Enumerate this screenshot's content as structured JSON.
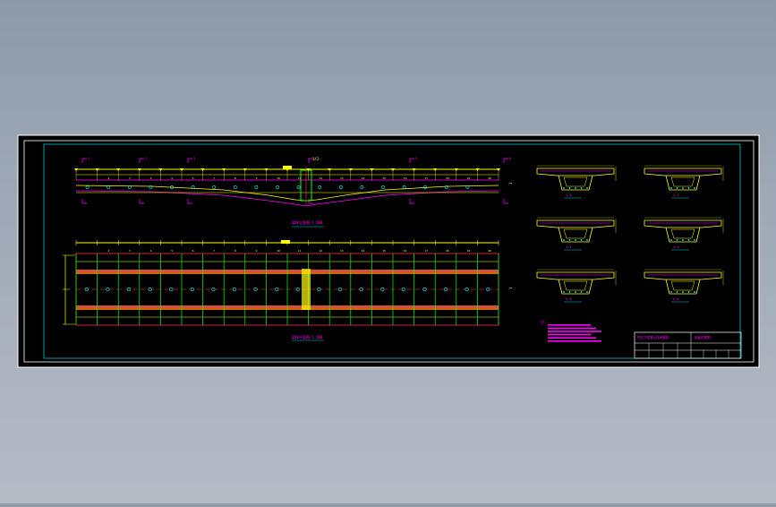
{
  "drawing": {
    "colors": {
      "background": "#000000",
      "frame": "#ffffff",
      "border": "#00c8c8",
      "deck": "#ffff00",
      "rebar": "#ff00ff",
      "pier": "#00ff00",
      "hatch": "#ff8000",
      "girder": "#00ffff",
      "red": "#ff3030"
    },
    "elevation": {
      "top_marker": "1/2",
      "left_marker": "1",
      "right_marker": "1",
      "title": "梁体立面图 1:100",
      "segment_numbers": [
        "2",
        "3",
        "4",
        "5",
        "6",
        "7",
        "8",
        "9",
        "10",
        "11",
        "12",
        "13",
        "14",
        "15",
        "16",
        "17",
        "18",
        "19",
        "20"
      ]
    },
    "plan": {
      "top_marker": "1/2",
      "right_marker": "1",
      "title": "梁体平面图 1:100",
      "segment_numbers": [
        "2",
        "3",
        "4",
        "5",
        "6",
        "7",
        "8",
        "9",
        "10",
        "11",
        "12",
        "13",
        "14",
        "15",
        "16",
        "17",
        "18",
        "19",
        "20"
      ]
    },
    "sections": [
      "1-1",
      "2-2",
      "3-3",
      "4-4",
      "5-5",
      "6-6"
    ],
    "notes": {
      "header": "注:",
      "lines_count": 6
    },
    "title_block": {
      "project": "预应力混凝土连续箱梁",
      "drawing_name": "钢束布置图"
    }
  }
}
